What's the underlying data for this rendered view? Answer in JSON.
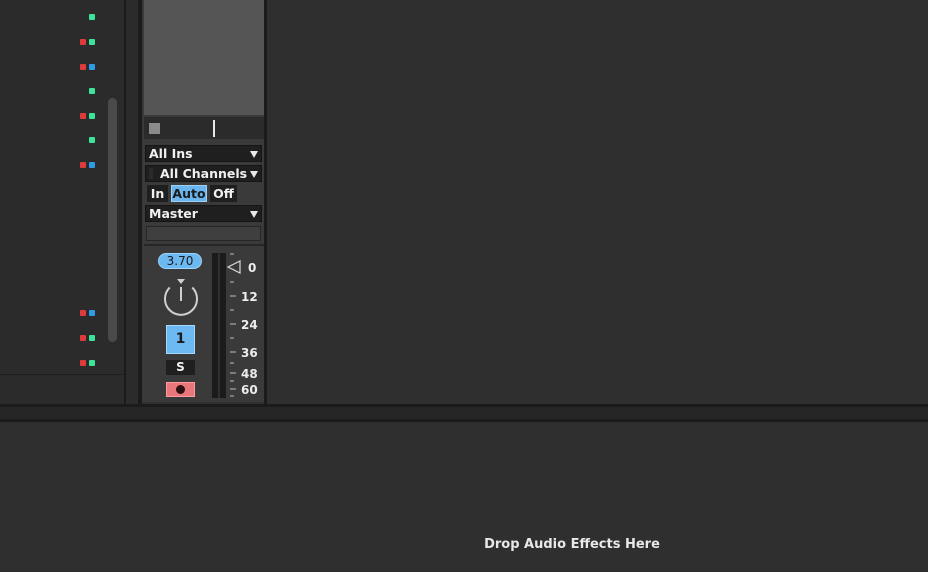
{
  "left_panel": {
    "indicator_rows": [
      {
        "colors": [
          "green"
        ]
      },
      {
        "colors": [
          "red",
          "green"
        ]
      },
      {
        "colors": [
          "red",
          "blue"
        ]
      },
      {
        "colors": [
          "green"
        ]
      },
      {
        "colors": [
          "red",
          "green"
        ]
      },
      {
        "colors": [
          "green"
        ]
      },
      {
        "colors": [
          "red",
          "blue"
        ]
      },
      {
        "colors": [
          "red",
          "blue"
        ]
      },
      {
        "colors": [
          "red",
          "green"
        ]
      },
      {
        "colors": [
          "red",
          "green"
        ]
      }
    ]
  },
  "mixer": {
    "input_type": "All Ins",
    "input_channel": "All Channels",
    "monitor": {
      "in": "In",
      "auto": "Auto",
      "off": "Off",
      "selected": "Auto"
    },
    "output": "Master",
    "pan_value": "3.70",
    "track_number": "1",
    "solo_label": "S",
    "meter_scale": [
      "0",
      "12",
      "24",
      "36",
      "48",
      "60"
    ]
  },
  "device_area": {
    "drop_hint": "Drop Audio Effects Here"
  },
  "colors": {
    "accent_blue": "#6cb8f0",
    "arm_red": "#e8767a",
    "indicator_green": "#3ce39a",
    "indicator_red": "#e03b3b",
    "indicator_blue": "#2f9be6"
  }
}
